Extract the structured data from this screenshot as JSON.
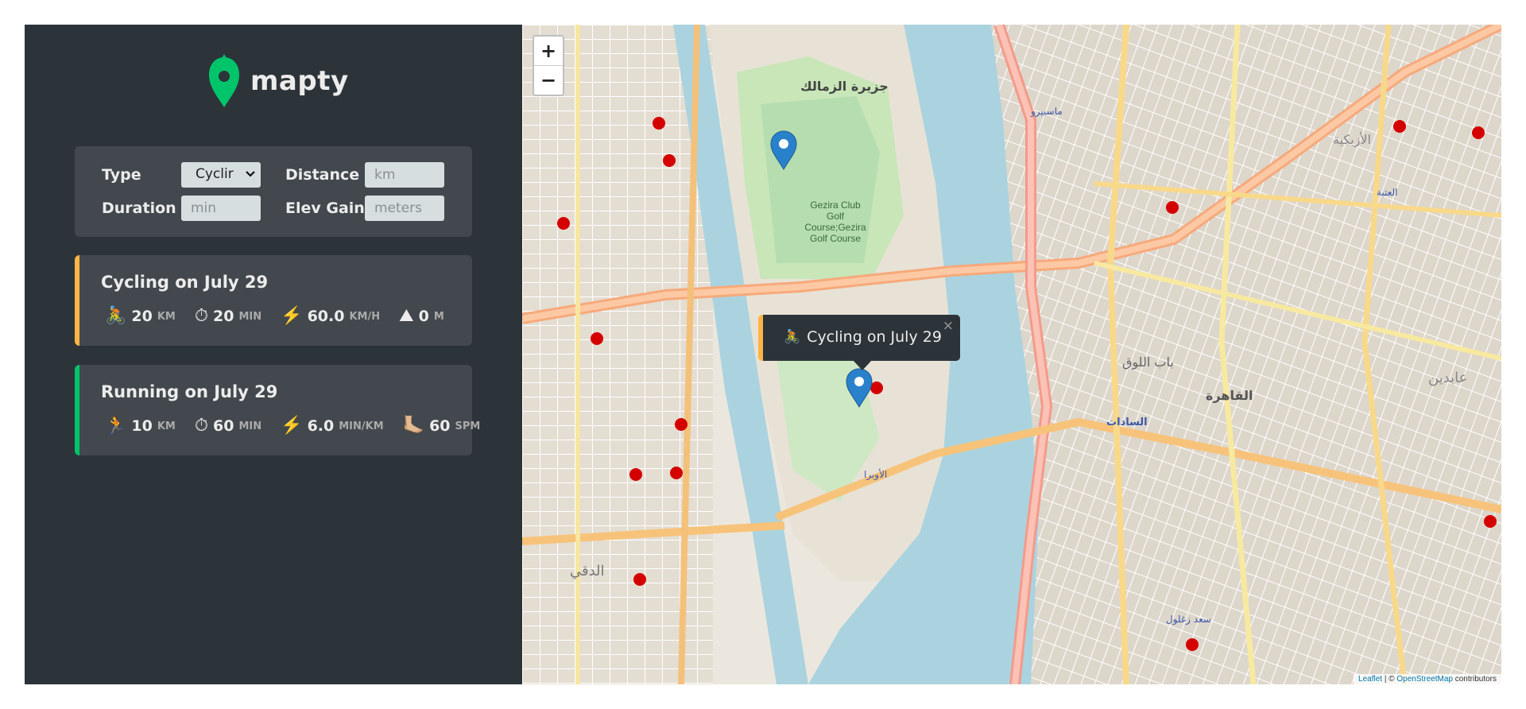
{
  "logo": {
    "text": "mapty",
    "brand_color": "#00c46a"
  },
  "form": {
    "type_label": "Type",
    "type_value": "Cyclir",
    "distance_label": "Distance",
    "distance_placeholder": "km",
    "duration_label": "Duration",
    "duration_placeholder": "min",
    "elev_label": "Elev Gain",
    "elev_placeholder": "meters"
  },
  "workouts": [
    {
      "title": "Cycling on July 29",
      "accent": "#ffb545",
      "details": [
        {
          "icon": "🚴",
          "value": "20",
          "unit": "km"
        },
        {
          "icon": "⏱",
          "value": "20",
          "unit": "min"
        },
        {
          "icon": "⚡️",
          "value": "60.0",
          "unit": "km/h"
        },
        {
          "icon": "⛰",
          "value": "0",
          "unit": "m"
        }
      ]
    },
    {
      "title": "Running on July 29",
      "accent": "#00c46a",
      "details": [
        {
          "icon": "🏃",
          "value": "10",
          "unit": "km"
        },
        {
          "icon": "⏱",
          "value": "60",
          "unit": "min"
        },
        {
          "icon": "⚡️",
          "value": "6.0",
          "unit": "min/km"
        },
        {
          "icon": "🦶🏼",
          "value": "60",
          "unit": "spm"
        }
      ]
    }
  ],
  "map": {
    "zoom_in": "+",
    "zoom_out": "−",
    "popup": {
      "icon": "🚴",
      "text": "Cycling on July 29",
      "close": "×"
    },
    "attribution": {
      "leaflet": "Leaflet",
      "sep": " | © ",
      "osm": "OpenStreetMap",
      "suffix": " contributors"
    },
    "labels": {
      "zamalek": "جزيرة الزمالك",
      "golf": "Gezira Club Golf Course;Gezira Golf Course",
      "tahrir": "القاهرة",
      "sadat": "السادات",
      "opera": "الأوبرا",
      "maspero": "ماسبيرو",
      "dokki": "الدقي",
      "saad": "سعد زغلول",
      "ataba": "العتبة",
      "bab_louq": "باب اللوق",
      "abdeen": "عابدين",
      "ezbekiya": "الأزبكية"
    }
  }
}
